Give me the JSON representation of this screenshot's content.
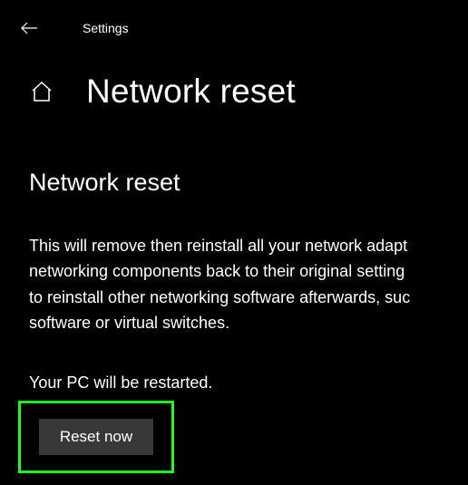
{
  "header": {
    "title": "Settings"
  },
  "page": {
    "title": "Network reset",
    "subtitle": "Network reset",
    "description_line1": "This will remove then reinstall all your network adapt",
    "description_line2": "networking components back to their original setting",
    "description_line3": "to reinstall other networking software afterwards, suc",
    "description_line4": "software or virtual switches.",
    "restart_note": "Your PC will be restarted."
  },
  "actions": {
    "reset_label": "Reset now"
  },
  "colors": {
    "highlight": "#1aff1a"
  }
}
